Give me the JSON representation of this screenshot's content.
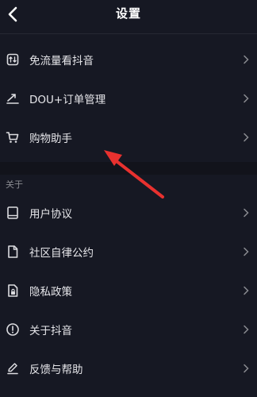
{
  "header": {
    "title": "设置"
  },
  "group1": [
    {
      "label": "免流量看抖音",
      "icon": "data-free-icon"
    },
    {
      "label": "DOU+订单管理",
      "icon": "trend-icon"
    },
    {
      "label": "购物助手",
      "icon": "cart-icon"
    }
  ],
  "section_about": {
    "label": "关于"
  },
  "group2": [
    {
      "label": "用户协议",
      "icon": "book-icon"
    },
    {
      "label": "社区自律公约",
      "icon": "document-icon"
    },
    {
      "label": "隐私政策",
      "icon": "privacy-lock-icon"
    },
    {
      "label": "关于抖音",
      "icon": "info-icon"
    },
    {
      "label": "反馈与帮助",
      "icon": "edit-icon"
    }
  ],
  "colors": {
    "background": "#161823",
    "text": "#e6e6ea",
    "muted": "#8a8b91",
    "annotation": "#e8312f"
  }
}
